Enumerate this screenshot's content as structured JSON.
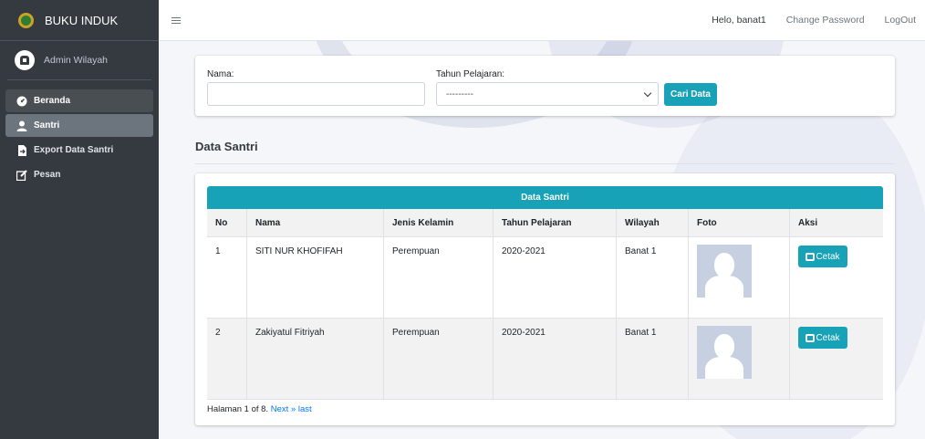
{
  "brand": {
    "title": "BUKU INDUK"
  },
  "user": {
    "name": "Admin Wilayah"
  },
  "sidebar": {
    "items": [
      {
        "label": "Beranda",
        "icon": "dashboard-icon"
      },
      {
        "label": "Santri",
        "icon": "user-icon"
      },
      {
        "label": "Export Data Santri",
        "icon": "file-export-icon"
      },
      {
        "label": "Pesan",
        "icon": "edit-icon"
      }
    ]
  },
  "topbar": {
    "greeting": "Helo, banat1",
    "change_password": "Change Password",
    "logout": "LogOut"
  },
  "search": {
    "name_label": "Nama:",
    "name_value": "",
    "year_label": "Tahun Pelajaran:",
    "year_selected": "---------",
    "button_label": "Cari Data"
  },
  "section": {
    "title": "Data Santri"
  },
  "table": {
    "caption": "Data Santri",
    "columns": [
      "No",
      "Nama",
      "Jenis Kelamin",
      "Tahun Pelajaran",
      "Wilayah",
      "Foto",
      "Aksi"
    ],
    "rows": [
      {
        "no": "1",
        "nama": "SITI NUR KHOFIFAH",
        "jk": "Perempuan",
        "tahun": "2020-2021",
        "wilayah": "Banat 1",
        "action": "Cetak"
      },
      {
        "no": "2",
        "nama": "Zakiyatul Fitriyah",
        "jk": "Perempuan",
        "tahun": "2020-2021",
        "wilayah": "Banat 1",
        "action": "Cetak"
      }
    ]
  },
  "pagination": {
    "text": "Halaman 1 of 8.",
    "next": "Next »",
    "last": "last"
  },
  "colors": {
    "accent": "#17a2b8",
    "sidebar": "#343a40",
    "link": "#007bff"
  }
}
